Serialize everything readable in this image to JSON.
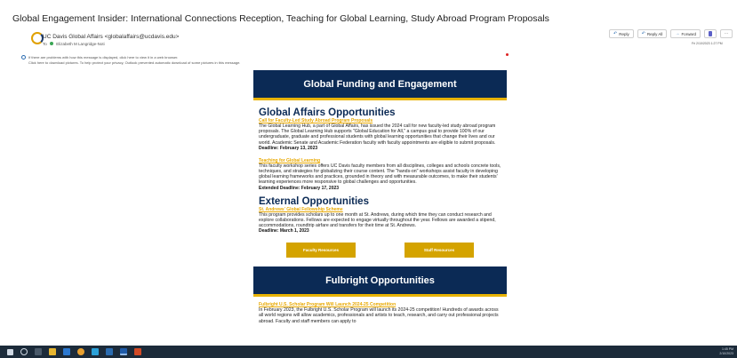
{
  "email": {
    "subject": "Global Engagement Insider: International Connections Reception, Teaching for Global Learning, Study Abroad Program Proposals",
    "sender": "UC Davis Global Affairs <globalaffairs@ucdavis.edu>",
    "to_label": "To",
    "recipient": "Elizabeth M Langridge-Noti",
    "timestamp": "Fri 2/10/2023 1:27 PM",
    "info_line1": "If there are problems with how this message is displayed, click here to view it in a web browser.",
    "info_line2": "Click here to download pictures. To help protect your privacy, Outlook prevented automatic download of some pictures in this message."
  },
  "actions": {
    "reply": "Reply",
    "reply_all": "Reply All",
    "forward": "Forward"
  },
  "icons": {
    "reply": "reply-icon",
    "reply_all": "reply-all-icon",
    "forward": "forward-icon",
    "teams": "teams-icon",
    "more": "more-icon"
  },
  "newsletter": {
    "banner1": "Global Funding and Engagement",
    "section1_title": "Global Affairs Opportunities",
    "item1": {
      "link": "Call for Faculty-Led Study Abroad Program Proposals",
      "body": "The Global Learning Hub, a part of Global Affairs, has issued the 2024 call for new faculty-led study abroad program proposals. The Global Learning Hub supports \"Global Education for All,\" a campus goal to provide 100% of our undergraduate, graduate and professional students with global learning opportunities that change their lives and our world. Academic Senate and Academic Federation faculty with faculty appointments are eligible to submit proposals.",
      "deadline": "Deadline: February 13, 2023"
    },
    "item2": {
      "link": "Teaching for Global Learning",
      "body": "This faculty workshop series offers UC Davis faculty members from all disciplines, colleges and schools concrete tools, techniques, and strategies for globalizing their course content. The \"hands-on\" workshops assist faculty in developing global learning frameworks and practices, grounded in theory and with measurable outcomes, to make their students' learning experiences more responsive to global challenges and opportunities.",
      "deadline": "Extended Deadline: February 17, 2023"
    },
    "section2_title": "External Opportunities",
    "item3": {
      "link": "St. Andrews' Global Fellowship Scheme",
      "body": "This program provides scholars up to one month at St. Andrews, during which time they can conduct research and explore collaborations. Fellows are expected to engage virtually throughout the year. Fellows are awarded a stipend, accommodations, roundtrip airfare and transfers for their time at St. Andrews.",
      "deadline": "Deadline: March 1, 2023"
    },
    "button_faculty": "Faculty Resources",
    "button_staff": "Staff Resources",
    "banner2": "Fulbright Opportunities",
    "item4": {
      "link": "Fulbright U.S. Scholar Program Will Launch 2024-25 Competition",
      "body": "In February 2023, the Fulbright U.S. Scholar Program will launch its 2024-25 competition! Hundreds of awards across all world regions will allow academics, professionals and artists to teach, research, and carry out professional projects abroad. Faculty and staff members can apply to"
    }
  },
  "taskbar": {
    "time": "1:45 PM",
    "date": "2/10/2023"
  },
  "colors": {
    "navy": "#0b2a55",
    "gold": "#e8b300",
    "button_gold": "#d4a300"
  }
}
